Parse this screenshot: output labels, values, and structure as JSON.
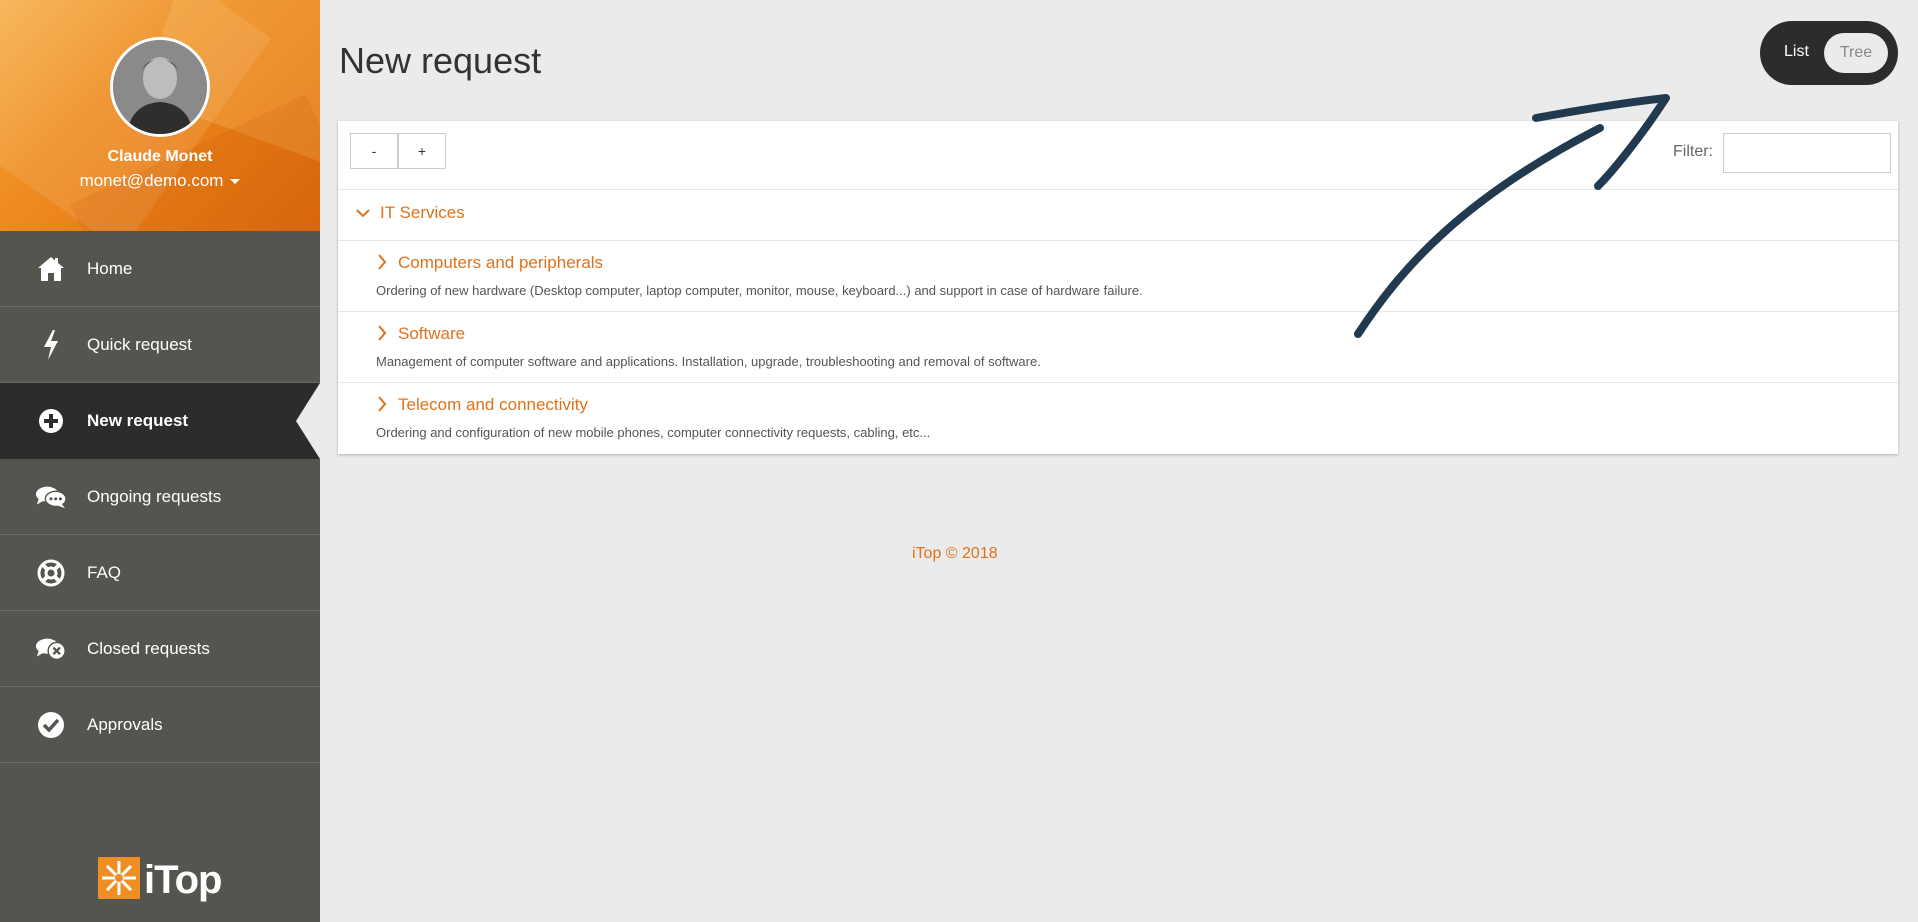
{
  "user": {
    "name": "Claude Monet",
    "email": "monet@demo.com"
  },
  "sidebar": {
    "items": [
      {
        "label": "Home",
        "icon": "home-icon",
        "active": false
      },
      {
        "label": "Quick request",
        "icon": "lightning-icon",
        "active": false
      },
      {
        "label": "New request",
        "icon": "plus-circle-icon",
        "active": true
      },
      {
        "label": "Ongoing requests",
        "icon": "chat-bubbles-icon",
        "active": false
      },
      {
        "label": "FAQ",
        "icon": "lifebuoy-icon",
        "active": false
      },
      {
        "label": "Closed requests",
        "icon": "chat-closed-icon",
        "active": false
      },
      {
        "label": "Approvals",
        "icon": "check-circle-icon",
        "active": false
      }
    ],
    "logo_text": "iTop"
  },
  "main": {
    "title": "New request",
    "view_toggle": {
      "list": "List",
      "tree": "Tree",
      "selected": "List"
    },
    "toolbar": {
      "collapse_label": "-",
      "expand_label": "+",
      "filter_label": "Filter:",
      "filter_value": ""
    },
    "group": {
      "label": "IT Services",
      "expanded": true
    },
    "services": [
      {
        "title": "Computers and peripherals",
        "description": "Ordering of new hardware (Desktop computer, laptop computer, monitor, mouse, keyboard...) and support in case of hardware failure."
      },
      {
        "title": "Software",
        "description": "Management of computer software and applications. Installation, upgrade, troubleshooting and removal of software."
      },
      {
        "title": "Telecom and connectivity",
        "description": "Ordering and configuration of new mobile phones, computer connectivity requests, cabling, etc..."
      }
    ],
    "footer": "iTop © 2018"
  },
  "colors": {
    "accent": "#e0721a",
    "sidebar": "#555550",
    "active_item": "#2c2c2a",
    "background": "#ebebeb",
    "annotation_arrow": "#223a4f"
  }
}
